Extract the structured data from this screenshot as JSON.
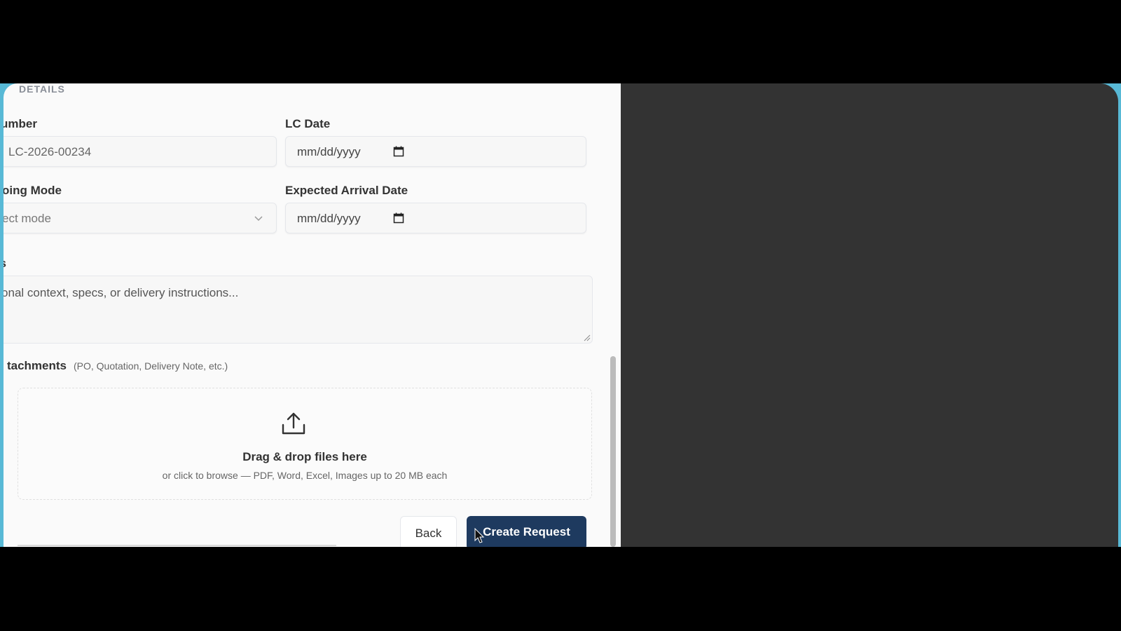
{
  "section": {
    "title": "DETAILS"
  },
  "fields": {
    "lc_number": {
      "label": "umber",
      "value": "LC-2026-00234"
    },
    "lc_date": {
      "label": "LC Date",
      "placeholder": "mm/dd/yyyy"
    },
    "shipping_mode": {
      "label": "oing Mode",
      "value": "ect mode"
    },
    "expected_arrival": {
      "label": "Expected Arrival Date",
      "placeholder": "mm/dd/yyyy"
    },
    "notes": {
      "label": "s",
      "placeholder": "litional context, specs, or delivery instructions..."
    }
  },
  "attachments": {
    "label": "tachments",
    "hint": "(PO, Quotation, Delivery Note, etc.)",
    "drop_title": "Drag & drop files here",
    "drop_subtitle": "or click to browse — PDF, Word, Excel, Images up to 20 MB each"
  },
  "buttons": {
    "back": "Back",
    "create": "Create Request"
  },
  "colors": {
    "primary": "#1e3a5f",
    "frame_accent": "#58b9d6",
    "dark_pane": "#333333"
  }
}
